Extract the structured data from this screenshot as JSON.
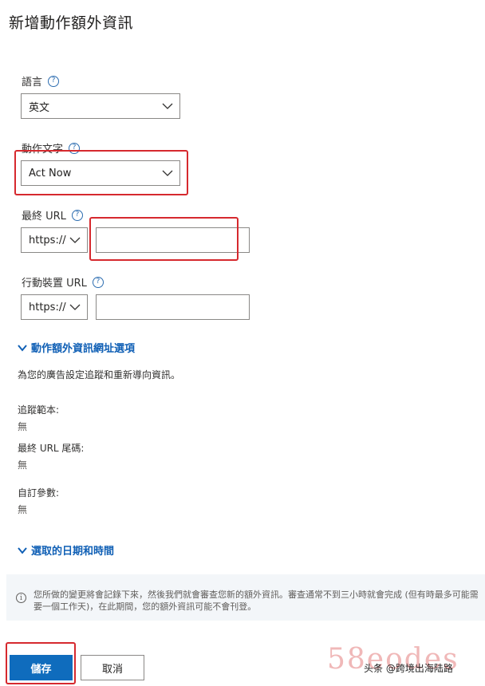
{
  "page": {
    "title": "新增動作額外資訊"
  },
  "language": {
    "label": "語言",
    "help": "?",
    "value": "英文"
  },
  "action_text": {
    "label": "動作文字",
    "help": "?",
    "value": "Act Now"
  },
  "final_url": {
    "label": "最終 URL",
    "help": "?",
    "protocol": "https://",
    "value": ""
  },
  "mobile_url": {
    "label": "行動裝置 URL",
    "help": "?",
    "protocol": "https://",
    "value": ""
  },
  "url_options": {
    "link": "動作額外資訊網址選項",
    "description": "為您的廣告設定追蹤和重新導向資訊。",
    "tracking_template": {
      "label": "追蹤範本:",
      "value": "無"
    },
    "final_url_suffix": {
      "label": "最終 URL 尾碼:",
      "value": "無"
    },
    "custom_params": {
      "label": "自訂參數:",
      "value": "無"
    }
  },
  "schedule": {
    "link": "選取的日期和時間"
  },
  "notice": {
    "icon": "info-icon",
    "text": "您所做的變更將會記錄下來，然後我們就會審查您新的額外資訊。審查通常不到三小時就會完成 (但有時最多可能需要一個工作天)，在此期間，您的額外資訊可能不會刊登。"
  },
  "buttons": {
    "save": "儲存",
    "cancel": "取消"
  },
  "watermark": {
    "main": "58eodes",
    "caption": "头条 @跨境出海陆路"
  },
  "colors": {
    "accent": "#0f6cbd",
    "highlight": "#d6292e",
    "link": "#0f5fb5"
  }
}
